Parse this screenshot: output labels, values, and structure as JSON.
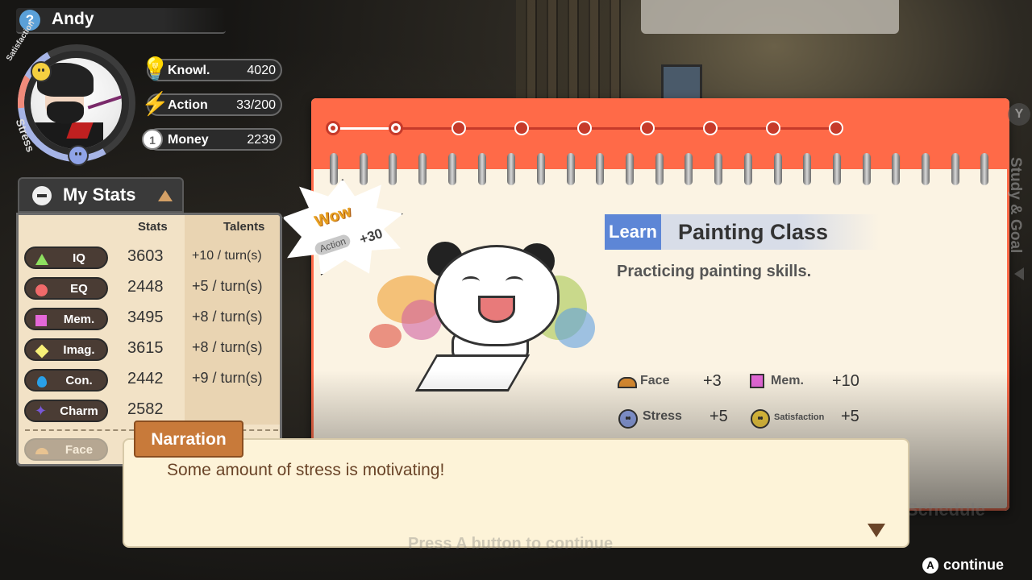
{
  "player": {
    "name": "Andy",
    "help_icon": "?",
    "satisfaction_label": "Satisfaction",
    "stress_label": "Stress"
  },
  "resources": [
    {
      "label": "Knowl.",
      "value": "4020",
      "icon": "lightbulb-icon"
    },
    {
      "label": "Action",
      "value": "33/200",
      "icon": "lightning-icon"
    },
    {
      "label": "Money",
      "value": "2239",
      "icon": "coin-icon",
      "glyph": "1"
    }
  ],
  "stats_panel": {
    "title": "My Stats",
    "col_stats": "Stats",
    "col_talents": "Talents",
    "rows": [
      {
        "name": "IQ",
        "value": "3603",
        "talent": "+10 / turn(s)",
        "shape": "triangle",
        "color": "#8ee060"
      },
      {
        "name": "EQ",
        "value": "2448",
        "talent": "+5 / turn(s)",
        "shape": "circle",
        "color": "#f06a6a"
      },
      {
        "name": "Mem.",
        "value": "3495",
        "talent": "+8 / turn(s)",
        "shape": "square",
        "color": "#e468d8"
      },
      {
        "name": "Imag.",
        "value": "3615",
        "talent": "+8 / turn(s)",
        "shape": "diamond",
        "color": "#f7f078"
      },
      {
        "name": "Con.",
        "value": "2442",
        "talent": "+9 / turn(s)",
        "shape": "drop",
        "color": "#29a0e8"
      },
      {
        "name": "Charm",
        "value": "2582",
        "talent": "",
        "shape": "star",
        "color": "#7858d8"
      },
      {
        "name": "Face",
        "value": "",
        "talent": "",
        "shape": "semicircle",
        "color": "#d88a30"
      }
    ]
  },
  "schedule": {
    "total_steps": 9,
    "completed_steps": 2
  },
  "activity": {
    "wow": "Wow",
    "wow_action": "Action",
    "wow_amount": "+30",
    "tag": "Learn",
    "title": "Painting Class",
    "description": "Practicing painting skills.",
    "effects": [
      {
        "label": "Face",
        "value": "+3",
        "icon": "face-icon"
      },
      {
        "label": "Mem.",
        "value": "+10",
        "icon": "memory-icon"
      },
      {
        "label": "Stress",
        "value": "+5",
        "icon": "stress-icon"
      },
      {
        "label": "Satisfaction",
        "value": "+5",
        "icon": "satisfaction-icon"
      }
    ]
  },
  "side": {
    "button": "Y",
    "label": "Study & Goal",
    "ghost_label": "Schedule"
  },
  "narration": {
    "tag": "Narration",
    "text": "Some amount of stress is motivating!",
    "ghost_hint": "Press A button to continue"
  },
  "continue": {
    "button": "A",
    "label": "continue"
  },
  "colors": {
    "notebook_accent": "#ff6a48",
    "learn_tag": "#5d86d6",
    "narration_tag": "#c87a3a"
  }
}
